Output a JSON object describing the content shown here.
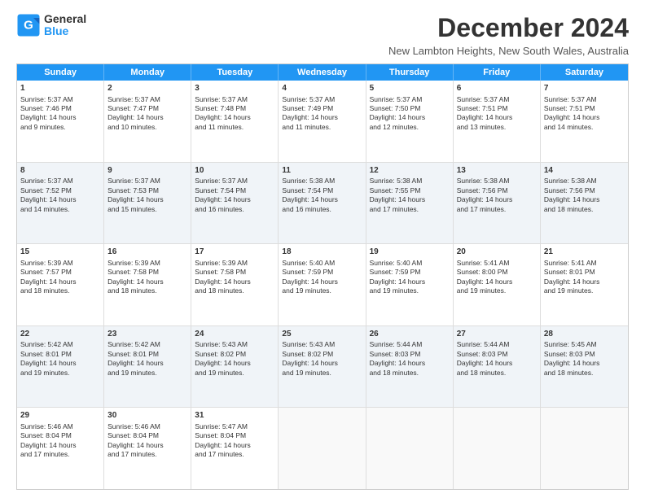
{
  "logo": {
    "general": "General",
    "blue": "Blue"
  },
  "title": "December 2024",
  "subtitle": "New Lambton Heights, New South Wales, Australia",
  "header_days": [
    "Sunday",
    "Monday",
    "Tuesday",
    "Wednesday",
    "Thursday",
    "Friday",
    "Saturday"
  ],
  "rows": [
    {
      "alt": false,
      "cells": [
        {
          "day": "1",
          "line1": "Sunrise: 5:37 AM",
          "line2": "Sunset: 7:46 PM",
          "line3": "Daylight: 14 hours",
          "line4": "and 9 minutes."
        },
        {
          "day": "2",
          "line1": "Sunrise: 5:37 AM",
          "line2": "Sunset: 7:47 PM",
          "line3": "Daylight: 14 hours",
          "line4": "and 10 minutes."
        },
        {
          "day": "3",
          "line1": "Sunrise: 5:37 AM",
          "line2": "Sunset: 7:48 PM",
          "line3": "Daylight: 14 hours",
          "line4": "and 11 minutes."
        },
        {
          "day": "4",
          "line1": "Sunrise: 5:37 AM",
          "line2": "Sunset: 7:49 PM",
          "line3": "Daylight: 14 hours",
          "line4": "and 11 minutes."
        },
        {
          "day": "5",
          "line1": "Sunrise: 5:37 AM",
          "line2": "Sunset: 7:50 PM",
          "line3": "Daylight: 14 hours",
          "line4": "and 12 minutes."
        },
        {
          "day": "6",
          "line1": "Sunrise: 5:37 AM",
          "line2": "Sunset: 7:51 PM",
          "line3": "Daylight: 14 hours",
          "line4": "and 13 minutes."
        },
        {
          "day": "7",
          "line1": "Sunrise: 5:37 AM",
          "line2": "Sunset: 7:51 PM",
          "line3": "Daylight: 14 hours",
          "line4": "and 14 minutes."
        }
      ]
    },
    {
      "alt": true,
      "cells": [
        {
          "day": "8",
          "line1": "Sunrise: 5:37 AM",
          "line2": "Sunset: 7:52 PM",
          "line3": "Daylight: 14 hours",
          "line4": "and 14 minutes."
        },
        {
          "day": "9",
          "line1": "Sunrise: 5:37 AM",
          "line2": "Sunset: 7:53 PM",
          "line3": "Daylight: 14 hours",
          "line4": "and 15 minutes."
        },
        {
          "day": "10",
          "line1": "Sunrise: 5:37 AM",
          "line2": "Sunset: 7:54 PM",
          "line3": "Daylight: 14 hours",
          "line4": "and 16 minutes."
        },
        {
          "day": "11",
          "line1": "Sunrise: 5:38 AM",
          "line2": "Sunset: 7:54 PM",
          "line3": "Daylight: 14 hours",
          "line4": "and 16 minutes."
        },
        {
          "day": "12",
          "line1": "Sunrise: 5:38 AM",
          "line2": "Sunset: 7:55 PM",
          "line3": "Daylight: 14 hours",
          "line4": "and 17 minutes."
        },
        {
          "day": "13",
          "line1": "Sunrise: 5:38 AM",
          "line2": "Sunset: 7:56 PM",
          "line3": "Daylight: 14 hours",
          "line4": "and 17 minutes."
        },
        {
          "day": "14",
          "line1": "Sunrise: 5:38 AM",
          "line2": "Sunset: 7:56 PM",
          "line3": "Daylight: 14 hours",
          "line4": "and 18 minutes."
        }
      ]
    },
    {
      "alt": false,
      "cells": [
        {
          "day": "15",
          "line1": "Sunrise: 5:39 AM",
          "line2": "Sunset: 7:57 PM",
          "line3": "Daylight: 14 hours",
          "line4": "and 18 minutes."
        },
        {
          "day": "16",
          "line1": "Sunrise: 5:39 AM",
          "line2": "Sunset: 7:58 PM",
          "line3": "Daylight: 14 hours",
          "line4": "and 18 minutes."
        },
        {
          "day": "17",
          "line1": "Sunrise: 5:39 AM",
          "line2": "Sunset: 7:58 PM",
          "line3": "Daylight: 14 hours",
          "line4": "and 18 minutes."
        },
        {
          "day": "18",
          "line1": "Sunrise: 5:40 AM",
          "line2": "Sunset: 7:59 PM",
          "line3": "Daylight: 14 hours",
          "line4": "and 19 minutes."
        },
        {
          "day": "19",
          "line1": "Sunrise: 5:40 AM",
          "line2": "Sunset: 7:59 PM",
          "line3": "Daylight: 14 hours",
          "line4": "and 19 minutes."
        },
        {
          "day": "20",
          "line1": "Sunrise: 5:41 AM",
          "line2": "Sunset: 8:00 PM",
          "line3": "Daylight: 14 hours",
          "line4": "and 19 minutes."
        },
        {
          "day": "21",
          "line1": "Sunrise: 5:41 AM",
          "line2": "Sunset: 8:01 PM",
          "line3": "Daylight: 14 hours",
          "line4": "and 19 minutes."
        }
      ]
    },
    {
      "alt": true,
      "cells": [
        {
          "day": "22",
          "line1": "Sunrise: 5:42 AM",
          "line2": "Sunset: 8:01 PM",
          "line3": "Daylight: 14 hours",
          "line4": "and 19 minutes."
        },
        {
          "day": "23",
          "line1": "Sunrise: 5:42 AM",
          "line2": "Sunset: 8:01 PM",
          "line3": "Daylight: 14 hours",
          "line4": "and 19 minutes."
        },
        {
          "day": "24",
          "line1": "Sunrise: 5:43 AM",
          "line2": "Sunset: 8:02 PM",
          "line3": "Daylight: 14 hours",
          "line4": "and 19 minutes."
        },
        {
          "day": "25",
          "line1": "Sunrise: 5:43 AM",
          "line2": "Sunset: 8:02 PM",
          "line3": "Daylight: 14 hours",
          "line4": "and 19 minutes."
        },
        {
          "day": "26",
          "line1": "Sunrise: 5:44 AM",
          "line2": "Sunset: 8:03 PM",
          "line3": "Daylight: 14 hours",
          "line4": "and 18 minutes."
        },
        {
          "day": "27",
          "line1": "Sunrise: 5:44 AM",
          "line2": "Sunset: 8:03 PM",
          "line3": "Daylight: 14 hours",
          "line4": "and 18 minutes."
        },
        {
          "day": "28",
          "line1": "Sunrise: 5:45 AM",
          "line2": "Sunset: 8:03 PM",
          "line3": "Daylight: 14 hours",
          "line4": "and 18 minutes."
        }
      ]
    },
    {
      "alt": false,
      "cells": [
        {
          "day": "29",
          "line1": "Sunrise: 5:46 AM",
          "line2": "Sunset: 8:04 PM",
          "line3": "Daylight: 14 hours",
          "line4": "and 17 minutes."
        },
        {
          "day": "30",
          "line1": "Sunrise: 5:46 AM",
          "line2": "Sunset: 8:04 PM",
          "line3": "Daylight: 14 hours",
          "line4": "and 17 minutes."
        },
        {
          "day": "31",
          "line1": "Sunrise: 5:47 AM",
          "line2": "Sunset: 8:04 PM",
          "line3": "Daylight: 14 hours",
          "line4": "and 17 minutes."
        },
        {
          "day": "",
          "line1": "",
          "line2": "",
          "line3": "",
          "line4": ""
        },
        {
          "day": "",
          "line1": "",
          "line2": "",
          "line3": "",
          "line4": ""
        },
        {
          "day": "",
          "line1": "",
          "line2": "",
          "line3": "",
          "line4": ""
        },
        {
          "day": "",
          "line1": "",
          "line2": "",
          "line3": "",
          "line4": ""
        }
      ]
    }
  ]
}
